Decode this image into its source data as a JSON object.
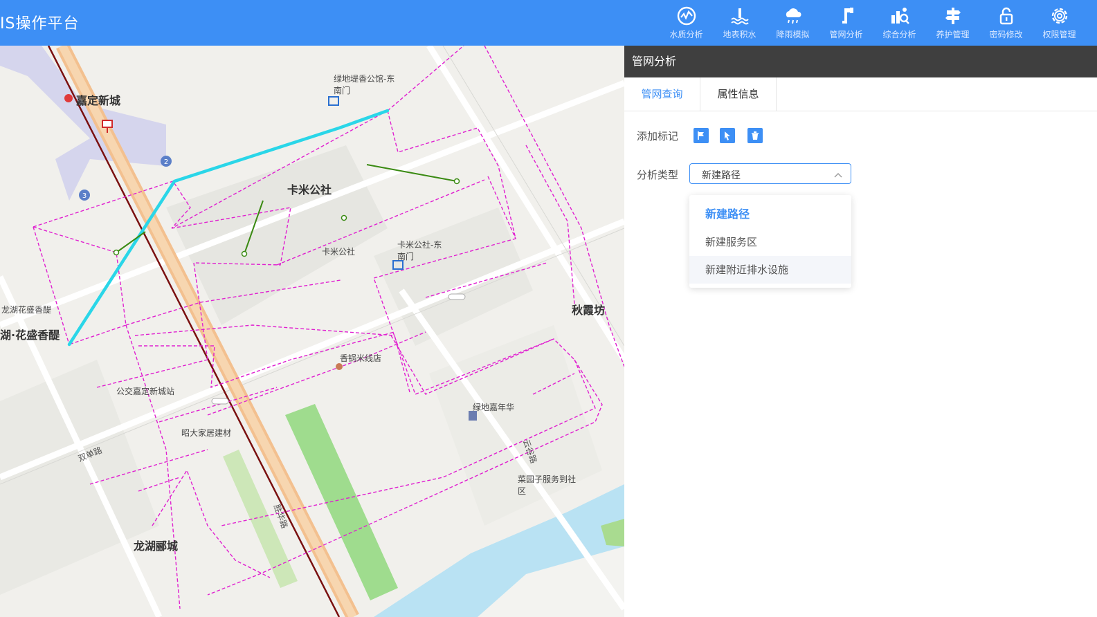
{
  "header": {
    "title": "IS操作平台",
    "nav": [
      {
        "label": "水质分析",
        "icon": "water-quality-icon"
      },
      {
        "label": "地表积水",
        "icon": "surface-water-icon"
      },
      {
        "label": "降雨模拟",
        "icon": "rain-cloud-icon"
      },
      {
        "label": "管网分析",
        "icon": "pipe-network-icon"
      },
      {
        "label": "综合分析",
        "icon": "comprehensive-analysis-icon"
      },
      {
        "label": "养护管理",
        "icon": "maintenance-icon"
      },
      {
        "label": "密码修改",
        "icon": "lock-icon"
      },
      {
        "label": "权限管理",
        "icon": "gear-icon"
      }
    ]
  },
  "map": {
    "labels": {
      "jiading": "嘉定新城",
      "lvdi_east": "绿地堤香公馆-东南门",
      "kami": "卡米公社",
      "kami_small": "卡米公社",
      "kami_east": "卡米公社-东南门",
      "qiuxia": "秋霞坊",
      "longhu": "龙湖花盛香醍",
      "longhu_big": "湖·花盛香醍",
      "xiangguo": "香锅米线店",
      "bus": "公交嘉定新城站",
      "jianfa": "昭大家居建材",
      "lvdi_jia": "绿地嘉年华",
      "caiyuan": "菜园子服务到社区",
      "longhu_city": "龙湖郦城",
      "shuangdan": "双单路",
      "shenghua": "胜华路",
      "yunqi": "云谷路"
    },
    "colors": {
      "pipe": "#e020d0",
      "route": "#2ad6e8",
      "branch": "#3a8a12"
    }
  },
  "panel": {
    "title": "管网分析",
    "tabs": [
      "管网查询",
      "属性信息"
    ],
    "add_mark_label": "添加标记",
    "analysis_type_label": "分析类型",
    "selected_value": "新建路径",
    "options": [
      "新建路径",
      "新建服务区",
      "新建附近排水设施"
    ],
    "tools": [
      "flag-icon",
      "pointer-icon",
      "trash-icon"
    ]
  }
}
